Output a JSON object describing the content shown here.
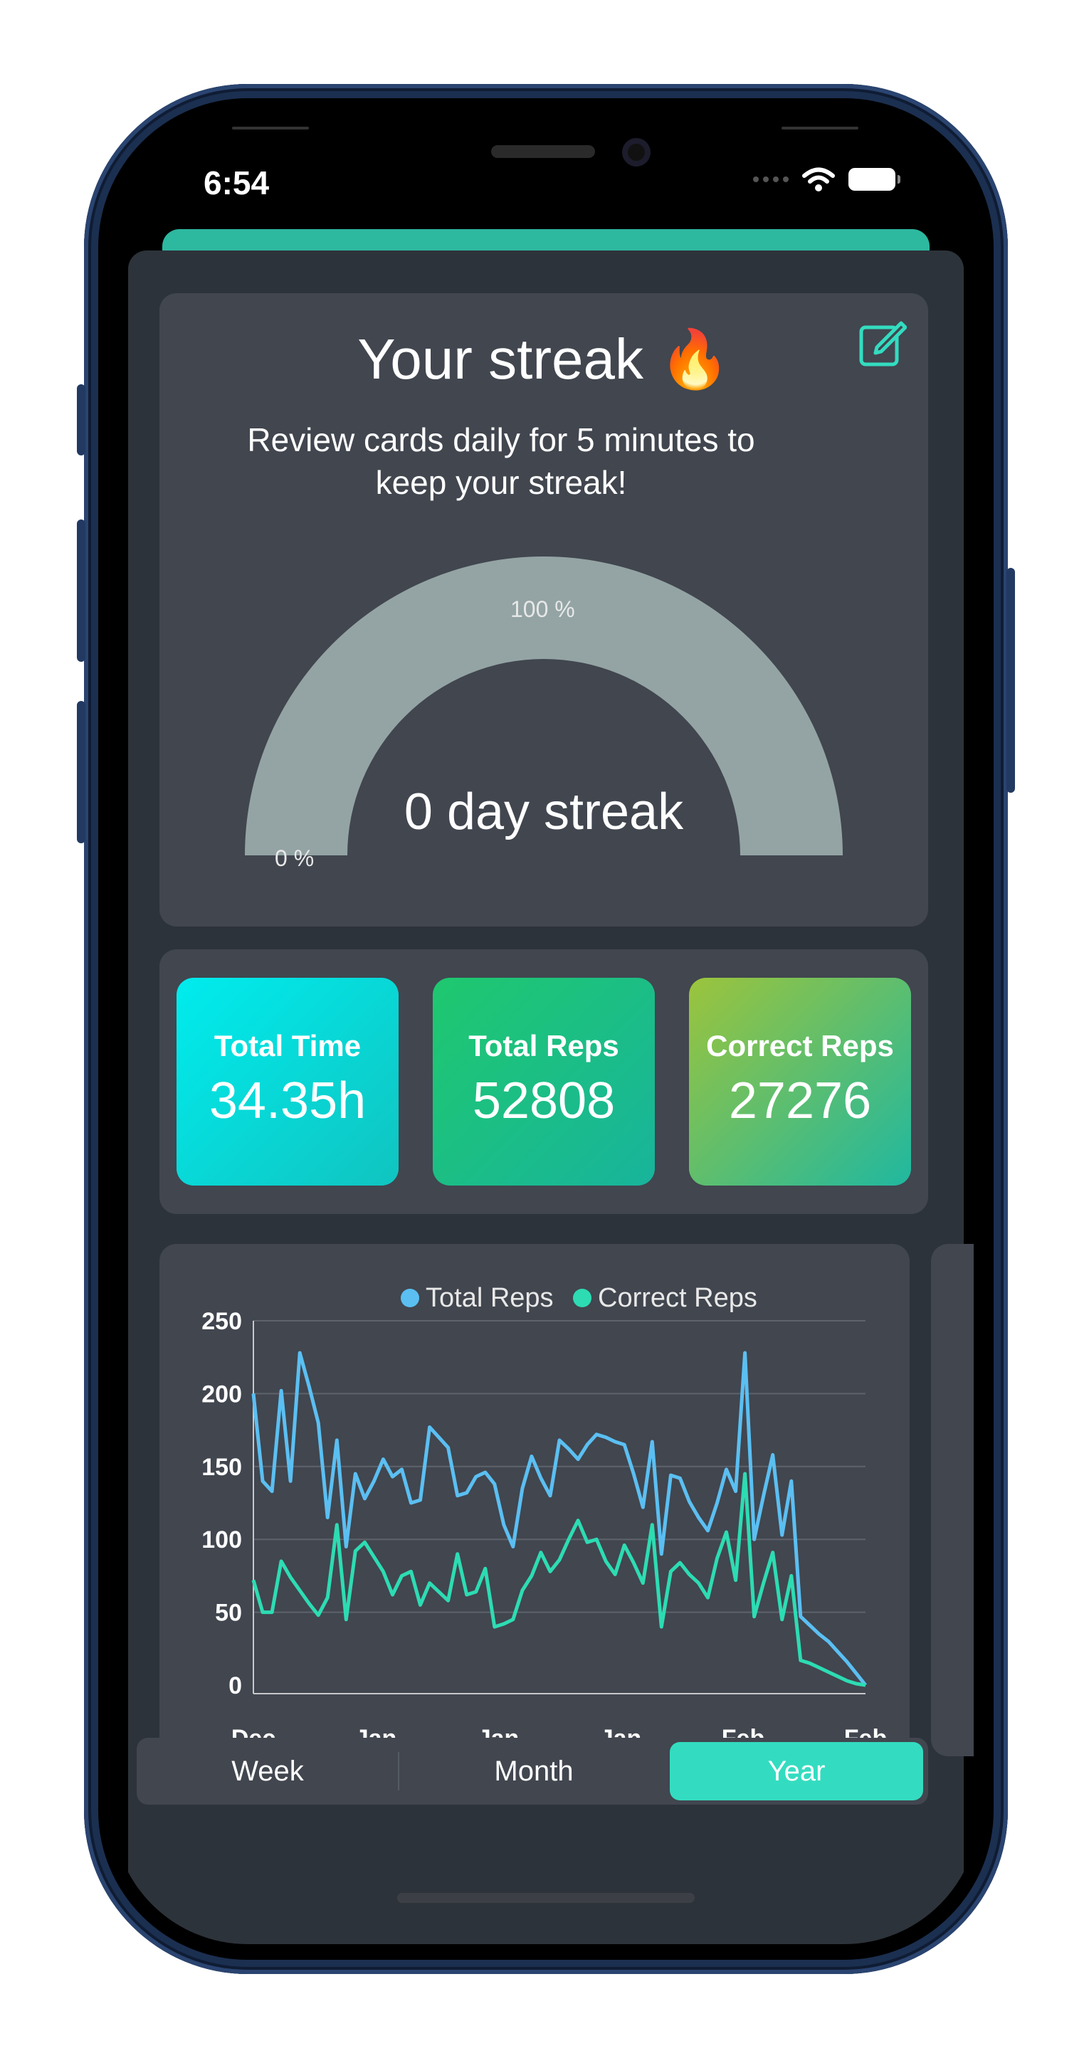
{
  "status_bar": {
    "time": "6:54"
  },
  "streak": {
    "title": "Your streak 🔥",
    "subtitle": "Review cards daily for 5 minutes to keep your streak!",
    "gauge_max_label": "100 %",
    "gauge_min_label": "0 %",
    "streak_label": "0 day streak",
    "gauge_fraction": 1.0
  },
  "stats": [
    {
      "label": "Total Time",
      "value": "34.35h"
    },
    {
      "label": "Total Reps",
      "value": "52808"
    },
    {
      "label": "Correct Reps",
      "value": "27276"
    }
  ],
  "colors": {
    "total_reps": "#5bbff2",
    "correct_reps": "#2ddcb3",
    "accent": "#33dcc0",
    "gauge": "#94a4a4"
  },
  "chart_data": {
    "type": "line",
    "x_tick_labels": [
      "Dec",
      "Jan",
      "Jan",
      "Jan",
      "Feb",
      "Feb"
    ],
    "ylim": [
      0,
      250
    ],
    "y_ticks": [
      0,
      50,
      100,
      150,
      200,
      250
    ],
    "grid": true,
    "legend": "top-center",
    "series": [
      {
        "name": "Total Reps",
        "values": [
          200,
          140,
          133,
          202,
          140,
          228,
          205,
          180,
          115,
          168,
          95,
          145,
          128,
          140,
          155,
          143,
          148,
          125,
          127,
          177,
          170,
          163,
          130,
          132,
          143,
          146,
          138,
          110,
          95,
          135,
          157,
          142,
          130,
          168,
          162,
          155,
          165,
          172,
          170,
          167,
          165,
          145,
          122,
          167,
          90,
          144,
          142,
          126,
          115,
          106,
          125,
          148,
          133,
          228,
          100,
          130,
          158,
          103,
          140,
          47,
          41,
          35,
          30,
          23,
          16,
          8,
          0
        ]
      },
      {
        "name": "Correct Reps",
        "values": [
          72,
          50,
          50,
          85,
          74,
          65,
          56,
          48,
          60,
          110,
          45,
          92,
          98,
          88,
          78,
          62,
          75,
          78,
          55,
          70,
          64,
          58,
          90,
          62,
          64,
          80,
          40,
          42,
          45,
          65,
          75,
          91,
          78,
          86,
          100,
          113,
          98,
          100,
          85,
          76,
          96,
          84,
          70,
          110,
          40,
          78,
          84,
          76,
          70,
          60,
          87,
          105,
          72,
          145,
          47,
          70,
          91,
          45,
          75,
          17,
          15,
          12,
          9,
          6,
          3,
          1,
          0
        ]
      }
    ]
  },
  "range_selector": {
    "options": [
      "Week",
      "Month",
      "Year"
    ],
    "selected": "Year"
  }
}
